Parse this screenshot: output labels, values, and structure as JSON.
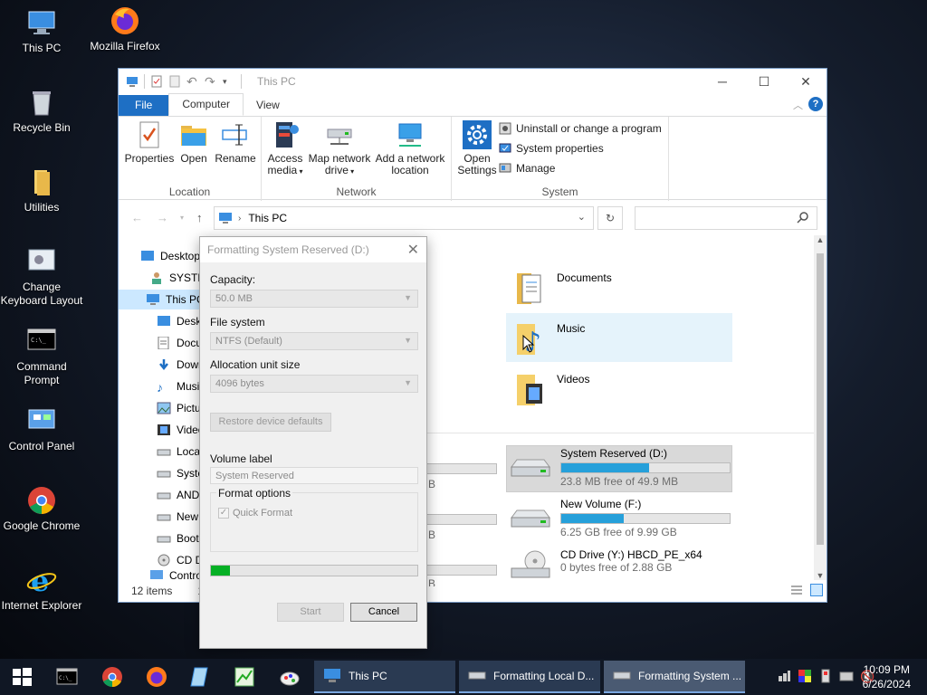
{
  "desktop": {
    "icons": [
      {
        "label": "This PC"
      },
      {
        "label": "Mozilla Firefox"
      },
      {
        "label": "Recycle Bin"
      },
      {
        "label": "Utilities"
      },
      {
        "label": "Change Keyboard Layout"
      },
      {
        "label": "Command Prompt"
      },
      {
        "label": "Control Panel"
      },
      {
        "label": "Google Chrome"
      },
      {
        "label": "Internet Explorer"
      }
    ]
  },
  "explorer": {
    "title": "This PC",
    "tabs": {
      "file": "File",
      "computer": "Computer",
      "view": "View"
    },
    "ribbon": {
      "location": {
        "label": "Location",
        "properties": "Properties",
        "open": "Open",
        "rename": "Rename"
      },
      "network": {
        "label": "Network",
        "access_media": "Access media",
        "map_drive": "Map network drive",
        "add_location": "Add a network location"
      },
      "system": {
        "label": "System",
        "open_settings": "Open Settings",
        "uninstall": "Uninstall or change a program",
        "system_properties": "System properties",
        "manage": "Manage"
      }
    },
    "address": "This PC",
    "search_placeholder": "",
    "tree": [
      "Desktop",
      "SYSTEM",
      "This PC",
      "Deskt",
      "Docu",
      "Down",
      "Music",
      "Pictur",
      "Video",
      "Local",
      "Syste",
      "ANDR",
      "New V",
      "Boot",
      "CD Dr",
      "Contro"
    ],
    "folders": [
      {
        "name": "Documents"
      },
      {
        "name": "Music"
      },
      {
        "name": "Videos"
      }
    ],
    "drives": [
      {
        "name": "System Reserved (D:)",
        "free": "23.8 MB free of 49.9 MB",
        "used_fraction": 0.52
      },
      {
        "name": "New Volume (F:)",
        "free": "6.25 GB free of 9.99 GB",
        "used_fraction": 0.37
      },
      {
        "name": "CD Drive (Y:) HBCD_PE_x64",
        "free": "0 bytes free of 2.88 GB",
        "used_fraction": 1.0
      }
    ],
    "left_drive_fragments": [
      "B",
      "B",
      "B"
    ],
    "status": {
      "items": "12 items",
      "selected": "1 i"
    }
  },
  "format_dialog": {
    "title": "Formatting System Reserved (D:)",
    "capacity_label": "Capacity:",
    "capacity_value": "50.0 MB",
    "filesystem_label": "File system",
    "filesystem_value": "NTFS (Default)",
    "allocation_label": "Allocation unit size",
    "allocation_value": "4096 bytes",
    "restore_label": "Restore device defaults",
    "volume_label_label": "Volume label",
    "volume_label_value": "System Reserved",
    "format_options_label": "Format options",
    "quick_format_label": "Quick Format",
    "progress_fraction": 0.09,
    "start_label": "Start",
    "cancel_label": "Cancel"
  },
  "taskbar": {
    "windows": [
      {
        "label": "This PC"
      },
      {
        "label": "Formatting Local D..."
      },
      {
        "label": "Formatting System ..."
      }
    ],
    "time": "10:09 PM",
    "date": "6/26/2024"
  }
}
